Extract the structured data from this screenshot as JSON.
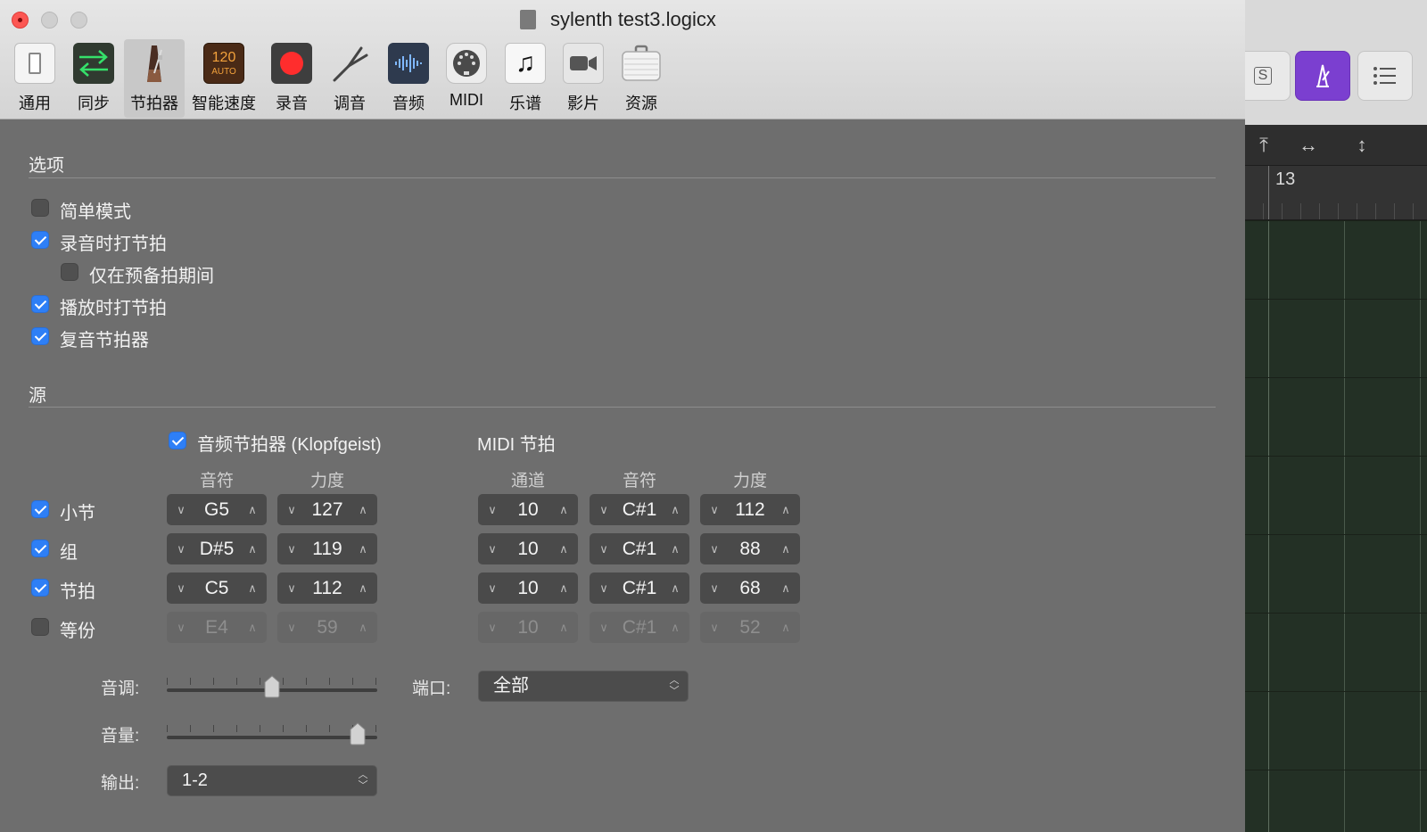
{
  "window": {
    "title": "sylenth test3.logicx"
  },
  "toolbar": {
    "items": [
      {
        "label": "通用",
        "icon": "general-switch-icon"
      },
      {
        "label": "同步",
        "icon": "sync-arrows-icon"
      },
      {
        "label": "节拍器",
        "icon": "metronome-icon",
        "selected": true
      },
      {
        "label": "智能速度",
        "icon": "smart-tempo-icon",
        "icon_text_top": "120",
        "icon_text_bottom": "AUTO"
      },
      {
        "label": "录音",
        "icon": "record-icon"
      },
      {
        "label": "调音",
        "icon": "tuning-fork-icon"
      },
      {
        "label": "音频",
        "icon": "audio-waveform-icon"
      },
      {
        "label": "MIDI",
        "icon": "midi-port-icon"
      },
      {
        "label": "乐谱",
        "icon": "music-note-icon"
      },
      {
        "label": "影片",
        "icon": "video-camera-icon"
      },
      {
        "label": "资源",
        "icon": "briefcase-icon"
      }
    ]
  },
  "options": {
    "title": "选项",
    "items": [
      {
        "label": "简单模式",
        "checked": false
      },
      {
        "label": "录音时打节拍",
        "checked": true
      },
      {
        "label": "仅在预备拍期间",
        "checked": false
      },
      {
        "label": "播放时打节拍",
        "checked": true
      },
      {
        "label": "复音节拍器",
        "checked": true
      }
    ]
  },
  "source": {
    "title": "源",
    "audio_click_label": "音频节拍器 (Klopfgeist)",
    "audio_click_checked": true,
    "midi_click_label": "MIDI 节拍",
    "col_headers": {
      "audio_note": "音符",
      "audio_velocity": "力度",
      "midi_channel": "通道",
      "midi_note": "音符",
      "midi_velocity": "力度"
    },
    "rows": [
      {
        "label": "小节",
        "checked": true,
        "audio_note": "G5",
        "audio_velocity": "127",
        "midi_channel": "10",
        "midi_note": "C#1",
        "midi_velocity": "112"
      },
      {
        "label": "组",
        "checked": true,
        "audio_note": "D#5",
        "audio_velocity": "119",
        "midi_channel": "10",
        "midi_note": "C#1",
        "midi_velocity": "88"
      },
      {
        "label": "节拍",
        "checked": true,
        "audio_note": "C5",
        "audio_velocity": "112",
        "midi_channel": "10",
        "midi_note": "C#1",
        "midi_velocity": "68"
      },
      {
        "label": "等份",
        "checked": false,
        "audio_note": "E4",
        "audio_velocity": "59",
        "midi_channel": "10",
        "midi_note": "C#1",
        "midi_velocity": "52"
      }
    ],
    "tone_label": "音调:",
    "tone_value": 0.5,
    "volume_label": "音量:",
    "volume_value": 0.95,
    "output_label": "输出:",
    "output_value": "1-2",
    "port_label": "端口:",
    "port_value": "全部"
  },
  "background_app": {
    "s_button": "S",
    "bar_number": "13"
  }
}
